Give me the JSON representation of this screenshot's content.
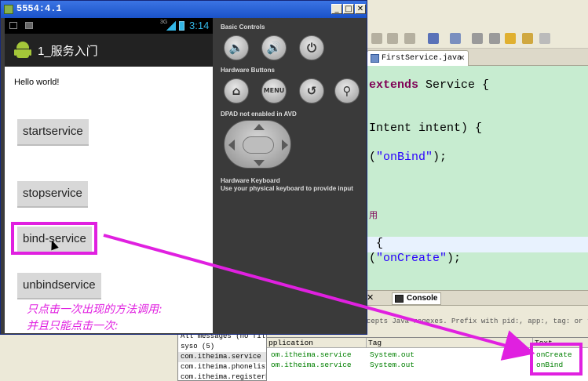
{
  "emulator": {
    "title": "5554:4.1",
    "controls": {
      "minimize": "_",
      "maximize": "□",
      "close": "✕"
    },
    "status_signal": "3G",
    "status_time": "3:14",
    "app_title": "1_服务入门",
    "hello_text": "Hello world!",
    "buttons": [
      "startservice",
      "stopservice",
      "bind-service",
      "unbindservice"
    ],
    "panel": {
      "basic_controls": "Basic Controls",
      "hardware_buttons": "Hardware Buttons",
      "menu_label": "MENU",
      "dpad_note": "DPAD not enabled in AVD",
      "keyboard_title": "Hardware Keyboard",
      "keyboard_note": "Use your physical keyboard to provide input"
    }
  },
  "eclipse": {
    "editor_tab": "FirstService.java",
    "code_lines": [
      {
        "kw": "extends",
        "rest": " Service {"
      },
      {
        "text": "Intent intent) {"
      },
      {
        "pre": "(",
        "str": "\"onBind\"",
        "post": ");"
      },
      {
        "text": "用"
      },
      {
        "text": " {"
      },
      {
        "pre": "(",
        "str": "\"onCreate\"",
        "post": ");"
      }
    ],
    "views_tab": "Console",
    "filter_hint": "cepts Java regexes. Prefix with pid:, app:, tag: or text",
    "filters": [
      "All messages (no filt",
      "syso (5)",
      "com.itheima.service (",
      "com.itheima.phonelist",
      "com.itheima.registerb"
    ],
    "log_columns": [
      "pplication",
      "Tag",
      "Text"
    ],
    "log_rows": [
      {
        "app": "om.itheima.service",
        "tag": "System.out",
        "text": "onCreate"
      },
      {
        "app": "om.itheima.service",
        "tag": "System.out",
        "text": "onBind"
      }
    ]
  },
  "annotation": {
    "line1": "只点击一次出现的方法调用:",
    "line2": "并且只能点击一次:",
    "color": "#e020e0"
  }
}
